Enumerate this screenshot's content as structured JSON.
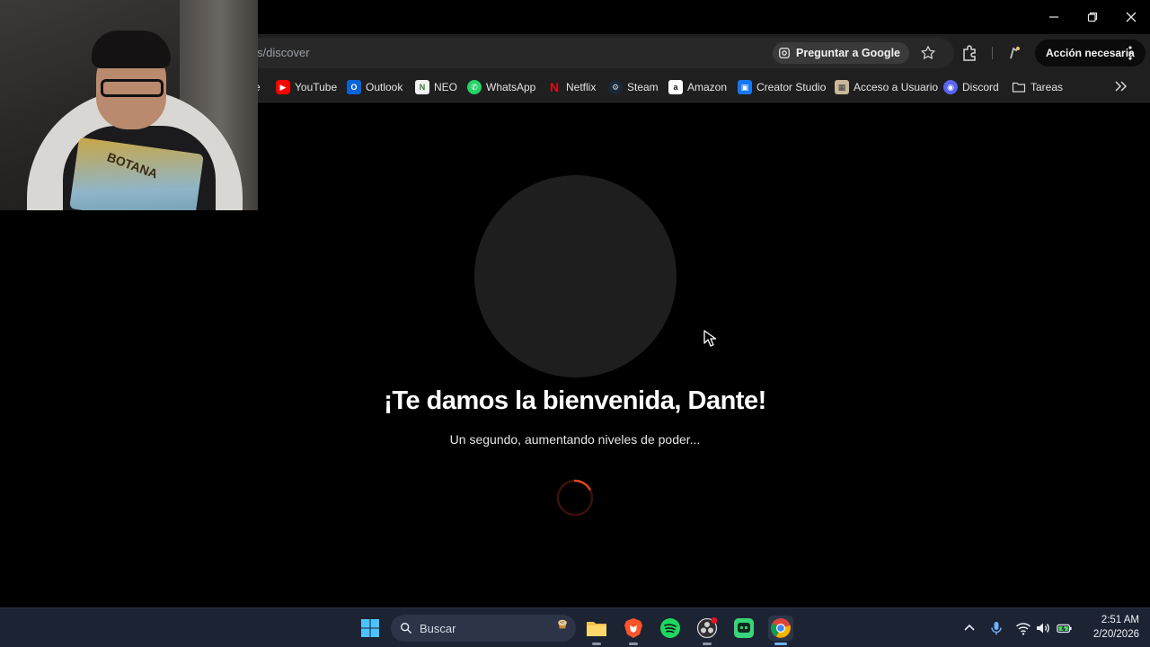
{
  "browser": {
    "url_visible": "s/discover",
    "ask_google_label": "Preguntar a Google",
    "action_button_label": "Acción necesaria",
    "bookmarks": [
      {
        "label": "e",
        "icon": "bookmark-partial-icon",
        "color": "#1f1f1f"
      },
      {
        "label": "YouTube",
        "icon": "youtube-icon",
        "color": "#ff0000"
      },
      {
        "label": "Outlook",
        "icon": "outlook-icon",
        "color": "#0a64d8"
      },
      {
        "label": "NEO",
        "icon": "neo-icon",
        "color": "#2e7d32"
      },
      {
        "label": "WhatsApp",
        "icon": "whatsapp-icon",
        "color": "#25d366"
      },
      {
        "label": "Netflix",
        "icon": "netflix-icon",
        "color": "#e50914"
      },
      {
        "label": "Steam",
        "icon": "steam-icon",
        "color": "#1b2838"
      },
      {
        "label": "Amazon",
        "icon": "amazon-icon",
        "color": "#ffffff"
      },
      {
        "label": "Creator Studio",
        "icon": "creator-studio-icon",
        "color": "#1877f2"
      },
      {
        "label": "Acceso a Usuario",
        "icon": "user-access-icon",
        "color": "#c9b89a"
      },
      {
        "label": "Discord",
        "icon": "discord-icon",
        "color": "#5865f2"
      },
      {
        "label": "Tareas",
        "icon": "folder-icon",
        "color": "#1f1f1f"
      }
    ]
  },
  "webcam": {
    "bag_text": "BOTANA"
  },
  "page": {
    "welcome_title": "¡Te damos la bienvenida, Dante!",
    "subtitle": "Un segundo, aumentando niveles de poder...",
    "spinner_color": "#e0451b"
  },
  "taskbar": {
    "search_placeholder": "Buscar",
    "apps": [
      "windows-start-icon",
      "file-explorer-icon",
      "brave-icon",
      "spotify-icon",
      "obs-icon",
      "app-icon",
      "chrome-icon"
    ],
    "time": "2:51 AM",
    "date": "2/20/2026"
  }
}
